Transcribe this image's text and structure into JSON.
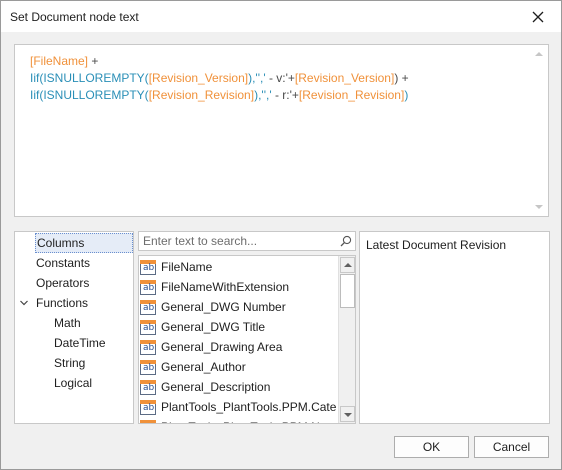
{
  "window": {
    "title": "Set Document node text"
  },
  "expression": {
    "lines": [
      [
        {
          "t": "[FileName]",
          "k": "field"
        },
        {
          "t": " +",
          "k": "op"
        }
      ],
      [
        {
          "t": "Iif(ISNULLOREMPTY(",
          "k": "fn"
        },
        {
          "t": "[Revision_Version]",
          "k": "field"
        },
        {
          "t": "),'','",
          "k": "fn"
        },
        {
          "t": " - v:'+",
          "k": "op"
        },
        {
          "t": "[Revision_Version]",
          "k": "field"
        },
        {
          "t": ") +",
          "k": "op"
        }
      ],
      [
        {
          "t": "Iif(ISNULLOREMPTY(",
          "k": "fn"
        },
        {
          "t": "[Revision_Revision]",
          "k": "field"
        },
        {
          "t": "),'','",
          "k": "fn"
        },
        {
          "t": " - r:'+",
          "k": "op"
        },
        {
          "t": "[Revision_Revision]",
          "k": "field"
        },
        {
          "t": ")",
          "k": "fn"
        }
      ]
    ]
  },
  "tree": {
    "items": [
      {
        "label": "Columns",
        "selected": true
      },
      {
        "label": "Constants"
      },
      {
        "label": "Operators"
      },
      {
        "label": "Functions",
        "expanded": true
      },
      {
        "label": "Math"
      },
      {
        "label": "DateTime"
      },
      {
        "label": "String"
      },
      {
        "label": "Logical"
      }
    ]
  },
  "search": {
    "placeholder": "Enter text to search..."
  },
  "columns_list": {
    "icon_text": "ab",
    "items": [
      "FileName",
      "FileNameWithExtension",
      "General_DWG Number",
      "General_DWG Title",
      "General_Drawing Area",
      "General_Author",
      "General_Description",
      "PlantTools_PlantTools.PPM.Categ...",
      "PlantTools_PlantTools.PPM.Next..."
    ]
  },
  "description": {
    "text": "Latest Document Revision"
  },
  "buttons": {
    "ok": "OK",
    "cancel": "Cancel"
  },
  "colors": {
    "function": "#2a8fb7",
    "field": "#f0913a",
    "operator": "#4a4a4a",
    "selection": "#e5ecf7"
  }
}
